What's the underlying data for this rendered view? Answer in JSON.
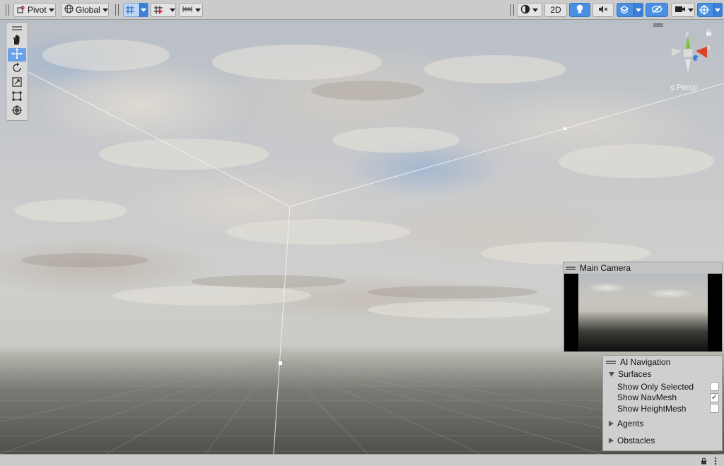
{
  "toolbar": {
    "pivot_label": "Pivot",
    "global_label": "Global",
    "mode_2d_label": "2D",
    "icons": [
      "pivot-icon",
      "globe-icon",
      "grid-snap-icon",
      "increment-snap-icon",
      "ruler-icon",
      "draw-mode-icon",
      "lighting-icon",
      "audio-mute-icon",
      "effects-icon",
      "hidden-objects-icon",
      "camera-icon",
      "gizmos-icon"
    ]
  },
  "tools": [
    "hand-tool",
    "move-tool",
    "rotate-tool",
    "scale-tool",
    "rect-tool",
    "transform-tool"
  ],
  "gizmo": {
    "y_axis": "y",
    "x_axis": "x",
    "z_axis": "z",
    "projection_label": "≤ Persp"
  },
  "camera_preview": {
    "title": "Main Camera"
  },
  "ai_navigation": {
    "title": "AI Navigation",
    "surfaces_label": "Surfaces",
    "options": [
      {
        "label": "Show Only Selected",
        "checked": false
      },
      {
        "label": "Show NavMesh",
        "checked": true
      },
      {
        "label": "Show HeightMesh",
        "checked": false
      }
    ],
    "agents_label": "Agents",
    "obstacles_label": "Obstacles"
  },
  "colors": {
    "accent": "#4a90e2",
    "x_axis": "#d9442b",
    "y_axis": "#7cc23a",
    "z_axis": "#3d7fd9"
  }
}
